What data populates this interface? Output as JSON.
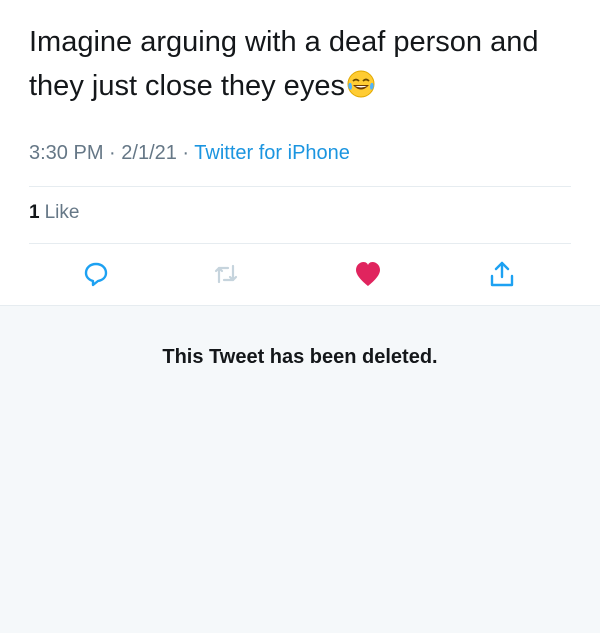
{
  "tweet": {
    "text": "Imagine arguing with a deaf person and they just close they eyes",
    "emoji": "rolling-on-floor-laughing-emoji",
    "time": "3:30 PM",
    "date": "2/1/21",
    "source": "Twitter for iPhone",
    "separator": " · "
  },
  "stats": {
    "like_count": "1",
    "like_label": "Like"
  },
  "actions": [
    {
      "name": "reply",
      "icon": "reply-icon"
    },
    {
      "name": "retweet",
      "icon": "retweet-icon"
    },
    {
      "name": "like",
      "icon": "heart-icon",
      "active": true
    },
    {
      "name": "share",
      "icon": "share-icon"
    }
  ],
  "deleted_notice": "This Tweet has been deleted.",
  "colors": {
    "text": "#14171a",
    "muted": "#657786",
    "link": "#1b95e0",
    "like_active": "#e0245e",
    "divider": "#e6ecf0",
    "deleted_bg": "#f5f8fa"
  }
}
